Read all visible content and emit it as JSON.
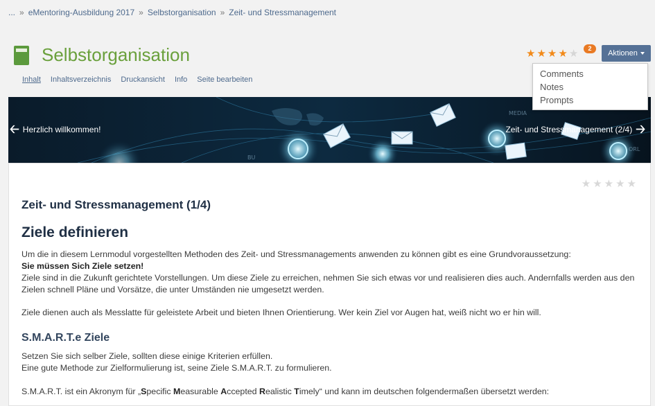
{
  "breadcrumb": {
    "items": [
      "...",
      "eMentoring-Ausbildung 2017",
      "Selbstorganisation",
      "Zeit- und Stressmanagement"
    ],
    "separator": "»"
  },
  "header": {
    "title": "Selbstorganisation",
    "icon": "book-icon"
  },
  "tabs": [
    {
      "label": "Inhalt",
      "active": true
    },
    {
      "label": "Inhaltsverzeichnis",
      "active": false
    },
    {
      "label": "Druckansicht",
      "active": false
    },
    {
      "label": "Info",
      "active": false
    },
    {
      "label": "Seite bearbeiten",
      "active": false
    }
  ],
  "rating": {
    "filled_stars": 4,
    "total_stars": 5,
    "count_badge": "2"
  },
  "actions": {
    "label": "Aktionen",
    "menu": [
      "Comments",
      "Notes",
      "Prompts"
    ]
  },
  "banner": {
    "prev_label": "Herzlich willkommen!",
    "next_label": "Zeit- und Stressmanagement (2/4)"
  },
  "content": {
    "rating_total": 5,
    "section_title": "Zeit- und Stressmanagement (1/4)",
    "heading": "Ziele definieren",
    "p1": "Um die in diesem Lernmodul vorgestellten Methoden des Zeit- und Stressmanagements anwenden zu können gibt es eine Grundvoraussetzung:",
    "p1_bold": "Sie müssen Sich Ziele setzen!",
    "p1_rest": "Ziele sind in die Zukunft gerichtete Vorstellungen. Um diese Ziele zu erreichen, nehmen Sie sich etwas vor und realisieren dies auch. Andernfalls werden aus den Zielen schnell Pläne und Vorsätze, die unter Umständen nie umgesetzt werden.",
    "p2": "Ziele dienen auch als Messlatte für geleistete Arbeit und bieten Ihnen Orientierung. Wer kein Ziel vor Augen hat, weiß nicht wo er hin will.",
    "subheading": "S.M.A.R.T.e Ziele",
    "p3_line1": "Setzen Sie sich selber Ziele, sollten diese einige Kriterien erfüllen.",
    "p3_line2": "Eine gute Methode zur Zielformulierung ist, seine Ziele S.M.A.R.T. zu formulieren.",
    "p4_prefix": "S.M.A.R.T. ist ein Akronym für „",
    "p4_words": [
      {
        "initial": "S",
        "rest": "pecific "
      },
      {
        "initial": "M",
        "rest": "easurable "
      },
      {
        "initial": "A",
        "rest": "ccepted "
      },
      {
        "initial": "R",
        "rest": "ealistic "
      },
      {
        "initial": "T",
        "rest": "imely"
      }
    ],
    "p4_suffix": "“ und kann im deutschen folgendermaßen übersetzt werden:"
  },
  "colors": {
    "title_green": "#6aa03c",
    "link_blue": "#4e6a8d",
    "star_orange": "#f28a1a",
    "button_blue": "#557196",
    "badge_orange": "#e97a24"
  }
}
